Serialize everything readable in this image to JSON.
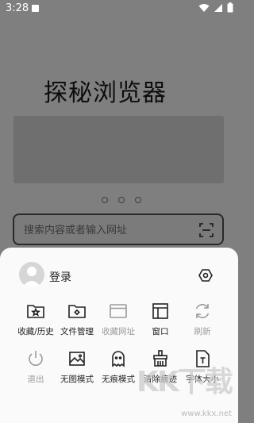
{
  "status_bar": {
    "time": "3:28"
  },
  "home": {
    "title": "探秘浏览器"
  },
  "search": {
    "placeholder": "搜索内容或者输入网址"
  },
  "sheet": {
    "login_label": "登录",
    "menu_items": [
      {
        "label": "收藏/历史",
        "icon": "bookmark-history-icon",
        "enabled": true
      },
      {
        "label": "文件管理",
        "icon": "file-manager-icon",
        "enabled": true
      },
      {
        "label": "收藏网址",
        "icon": "add-bookmark-icon",
        "enabled": false
      },
      {
        "label": "窗口",
        "icon": "window-icon",
        "enabled": true
      },
      {
        "label": "刷新",
        "icon": "refresh-icon",
        "enabled": false
      },
      {
        "label": "退出",
        "icon": "power-icon",
        "enabled": false
      },
      {
        "label": "无图模式",
        "icon": "no-image-icon",
        "enabled": true
      },
      {
        "label": "无痕模式",
        "icon": "incognito-ghost-icon",
        "enabled": true
      },
      {
        "label": "清除痕迹",
        "icon": "clear-brush-icon",
        "enabled": true
      },
      {
        "label": "字体大小",
        "icon": "font-size-icon",
        "enabled": true
      }
    ]
  },
  "watermark": {
    "logo_text": "KK下载",
    "url": "www.kkx.net"
  }
}
